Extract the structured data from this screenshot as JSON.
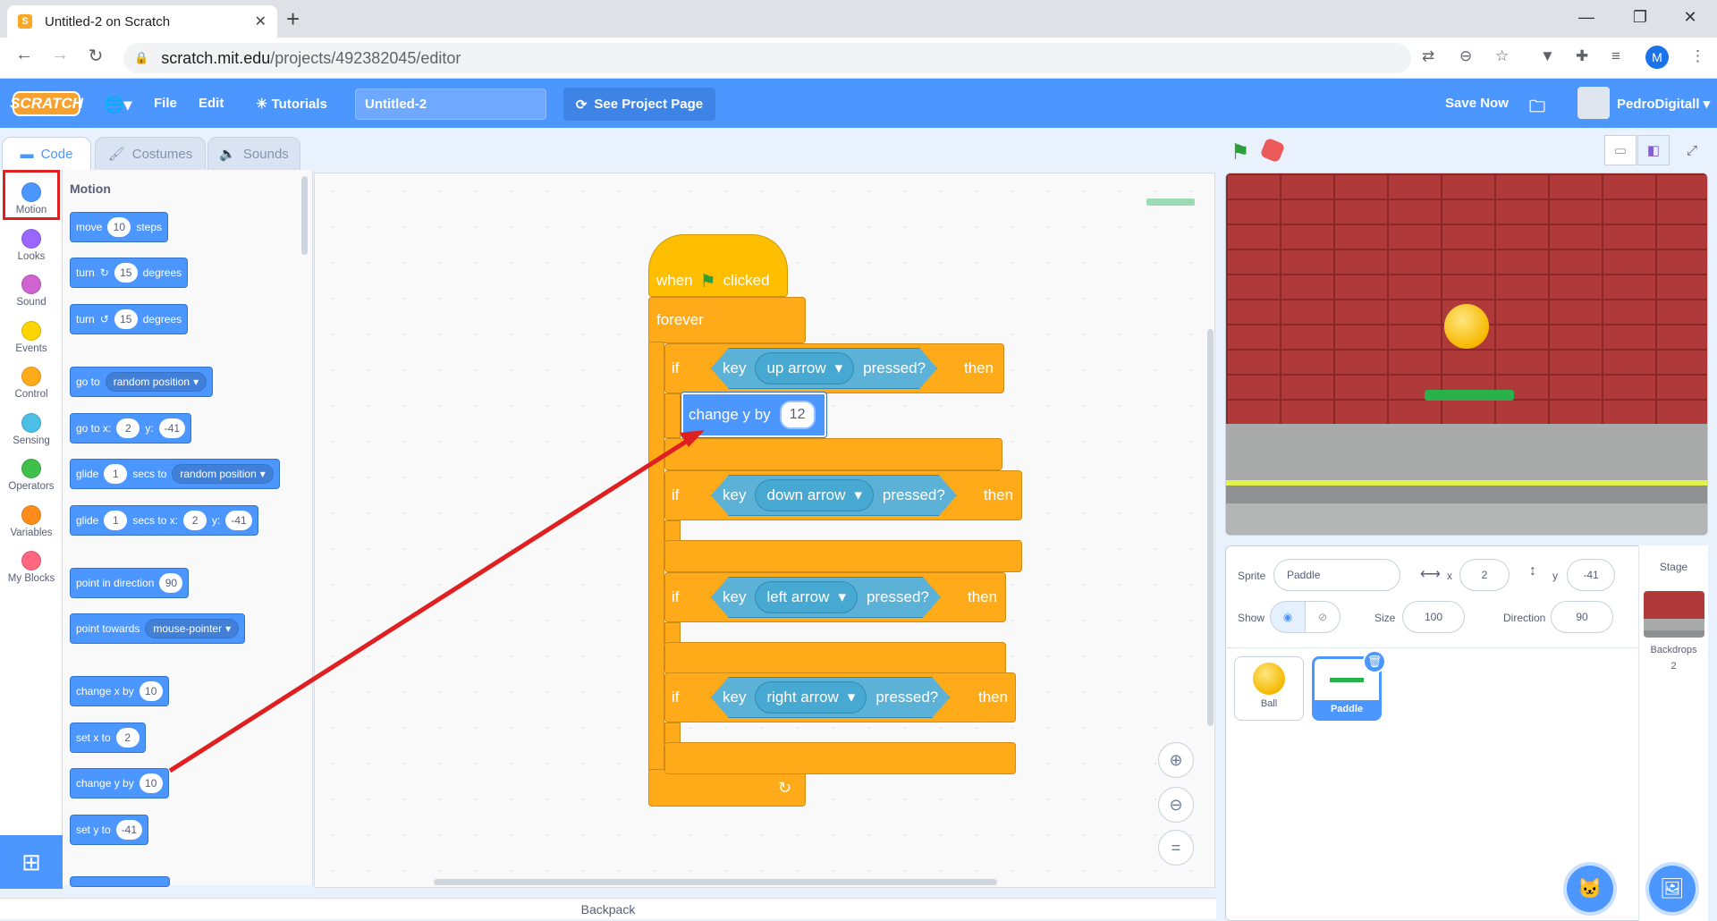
{
  "browser": {
    "tab_title": "Untitled-2 on Scratch",
    "tab_favicon_letter": "S",
    "url_host": "scratch.mit.edu",
    "url_path": "/projects/492382045/editor",
    "profile_letter": "M"
  },
  "menubar": {
    "logo": "SCRATCH",
    "file": "File",
    "edit": "Edit",
    "tutorials": "Tutorials",
    "project_title": "Untitled-2",
    "see_project": "See Project Page",
    "save_now": "Save Now",
    "username": "PedroDigitall"
  },
  "editor_tabs": {
    "code": "Code",
    "costumes": "Costumes",
    "sounds": "Sounds"
  },
  "categories": [
    {
      "label": "Motion",
      "color": "#4c97ff"
    },
    {
      "label": "Looks",
      "color": "#9966ff"
    },
    {
      "label": "Sound",
      "color": "#cf63cf"
    },
    {
      "label": "Events",
      "color": "#ffd500"
    },
    {
      "label": "Control",
      "color": "#ffab19"
    },
    {
      "label": "Sensing",
      "color": "#4cbfe6"
    },
    {
      "label": "Operators",
      "color": "#40bf4a"
    },
    {
      "label": "Variables",
      "color": "#ff8c1a"
    },
    {
      "label": "My Blocks",
      "color": "#ff6680"
    }
  ],
  "palette": {
    "heading": "Motion",
    "move": {
      "a": "move",
      "v": "10",
      "b": "steps"
    },
    "turn_right": {
      "a": "turn",
      "v": "15",
      "b": "degrees"
    },
    "turn_left": {
      "a": "turn",
      "v": "15",
      "b": "degrees"
    },
    "goto_random": {
      "a": "go to",
      "d": "random position"
    },
    "goto_xy": {
      "a": "go to x:",
      "x": "2",
      "b": "y:",
      "y": "-41"
    },
    "glide_random": {
      "a": "glide",
      "v": "1",
      "b": "secs to",
      "d": "random position"
    },
    "glide_xy": {
      "a": "glide",
      "v": "1",
      "b": "secs to x:",
      "x": "2",
      "c": "y:",
      "y": "-41"
    },
    "point_dir": {
      "a": "point in direction",
      "v": "90"
    },
    "point_towards": {
      "a": "point towards",
      "d": "mouse-pointer"
    },
    "change_x": {
      "a": "change x by",
      "v": "10"
    },
    "set_x": {
      "a": "set x to",
      "v": "2"
    },
    "change_y": {
      "a": "change y by",
      "v": "10"
    },
    "set_y": {
      "a": "set y to",
      "v": "-41"
    }
  },
  "script": {
    "hat_when": "when",
    "hat_clicked": "clicked",
    "forever": "forever",
    "if": "if",
    "key": "key",
    "pressed": "pressed?",
    "then": "then",
    "key1": "up arrow",
    "key2": "down arrow",
    "key3": "left arrow",
    "key4": "right arrow",
    "change_y_label": "change y by",
    "change_y_value": "12"
  },
  "sprite_info": {
    "sprite_label": "Sprite",
    "sprite_name": "Paddle",
    "x_label": "x",
    "x_value": "2",
    "y_label": "y",
    "y_value": "-41",
    "show_label": "Show",
    "size_label": "Size",
    "size_value": "100",
    "direction_label": "Direction",
    "direction_value": "90"
  },
  "sprites": [
    {
      "name": "Ball"
    },
    {
      "name": "Paddle"
    }
  ],
  "stage_panel": {
    "title": "Stage",
    "backdrops_label": "Backdrops",
    "backdrops_count": "2"
  },
  "backpack": "Backpack",
  "colors": {
    "accent": "#4c97ff",
    "annotation": "#e02020"
  }
}
